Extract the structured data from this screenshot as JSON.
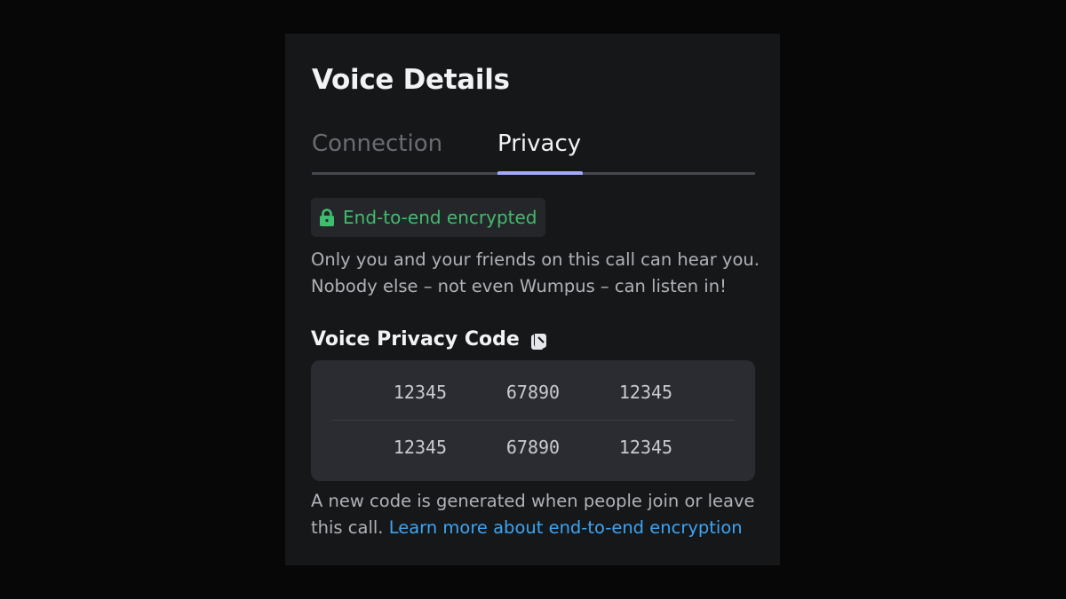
{
  "panel": {
    "title": "Voice Details"
  },
  "tabs": [
    {
      "label": "Connection",
      "active": false
    },
    {
      "label": "Privacy",
      "active": true
    }
  ],
  "encryption_badge": {
    "icon": "lock-icon",
    "text": "End-to-end encrypted",
    "color": "#3fbd6e"
  },
  "description": {
    "line1": "Only you and your friends on this call can hear you.",
    "line2": "Nobody else – not even Wumpus – can listen in!"
  },
  "privacy_code": {
    "title": "Voice Privacy Code",
    "icon": "copy-icon",
    "rows": [
      [
        "12345",
        "67890",
        "12345"
      ],
      [
        "12345",
        "67890",
        "12345"
      ]
    ]
  },
  "footer": {
    "text": "A new code is generated when people join or leave this call.",
    "link": "Learn more about end-to-end encryption",
    "link_color": "#3ea4f2"
  },
  "colors": {
    "accent": "#a3a9f4",
    "background": "#161719"
  }
}
